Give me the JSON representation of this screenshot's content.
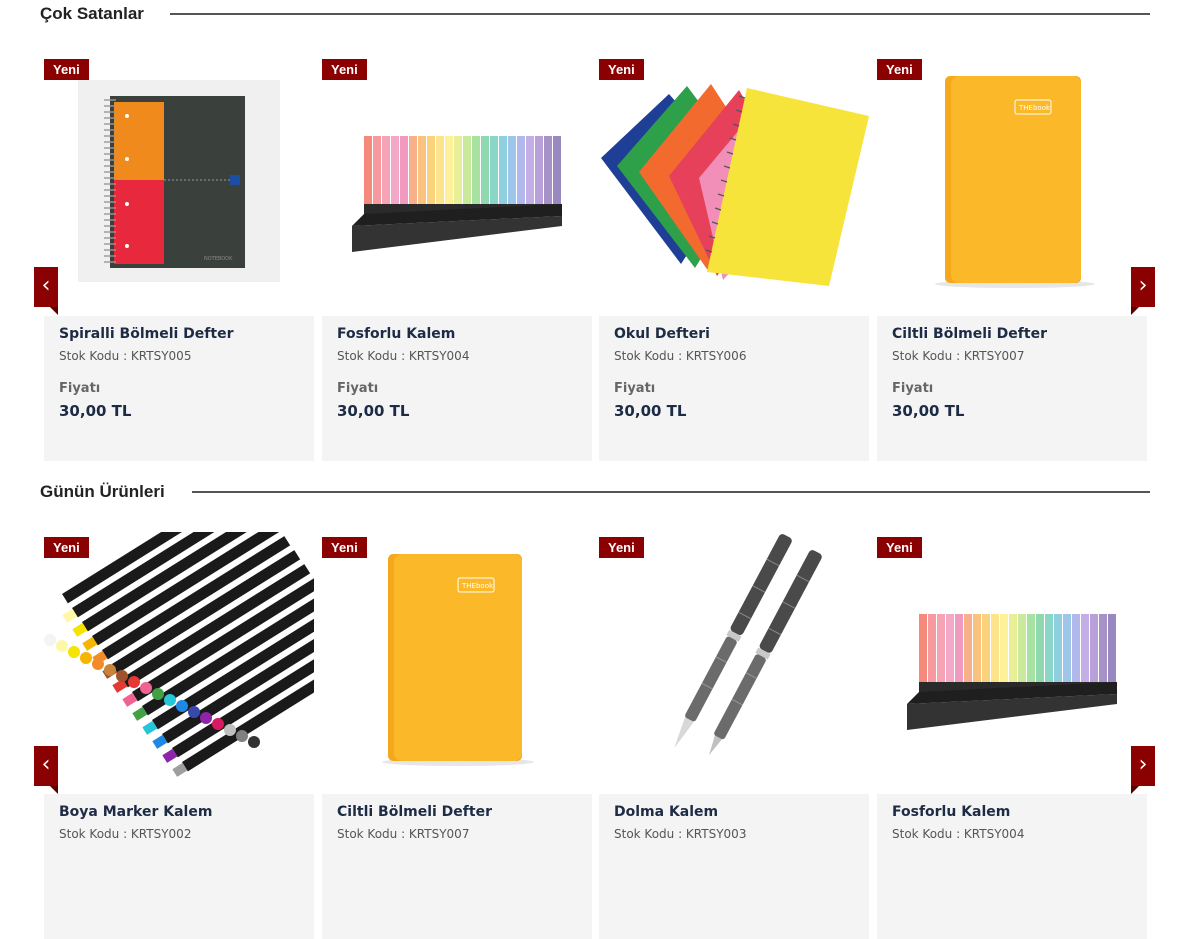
{
  "sections": [
    {
      "title": "Çok Satanlar",
      "prev_arrow": "‹",
      "next_arrow": "›",
      "products": [
        {
          "badge": "Yeni",
          "name": "Spiralli Bölmeli Defter",
          "code": "Stok Kodu : KRTSY005",
          "price_label": "Fiyatı",
          "price": "30,00 TL",
          "image": "spiral-notebook"
        },
        {
          "badge": "Yeni",
          "name": "Fosforlu Kalem",
          "code": "Stok Kodu : KRTSY004",
          "price_label": "Fiyatı",
          "price": "30,00 TL",
          "image": "highlighter-set"
        },
        {
          "badge": "Yeni",
          "name": "Okul Defteri",
          "code": "Stok Kodu : KRTSY006",
          "price_label": "Fiyatı",
          "price": "30,00 TL",
          "image": "school-notebooks"
        },
        {
          "badge": "Yeni",
          "name": "Ciltli Bölmeli Defter",
          "code": "Stok Kodu : KRTSY007",
          "price_label": "Fiyatı",
          "price": "30,00 TL",
          "image": "hardcover-notebook"
        }
      ]
    },
    {
      "title": "Günün Ürünleri",
      "prev_arrow": "‹",
      "next_arrow": "›",
      "products": [
        {
          "badge": "Yeni",
          "name": "Boya Marker Kalem",
          "code": "Stok Kodu : KRTSY002",
          "image": "paint-markers"
        },
        {
          "badge": "Yeni",
          "name": "Ciltli Bölmeli Defter",
          "code": "Stok Kodu : KRTSY007",
          "image": "hardcover-notebook"
        },
        {
          "badge": "Yeni",
          "name": "Dolma Kalem",
          "code": "Stok Kodu : KRTSY003",
          "image": "fountain-pens"
        },
        {
          "badge": "Yeni",
          "name": "Fosforlu Kalem",
          "code": "Stok Kodu : KRTSY004",
          "image": "highlighter-set"
        }
      ]
    }
  ],
  "colors": {
    "accent": "#8b0000",
    "card_bg": "#f4f4f4",
    "name_text": "#1d2b45",
    "notebook_yellow": "#fbb829"
  },
  "book_label": "THEbook",
  "notebook_label": "NOTEBOOK"
}
